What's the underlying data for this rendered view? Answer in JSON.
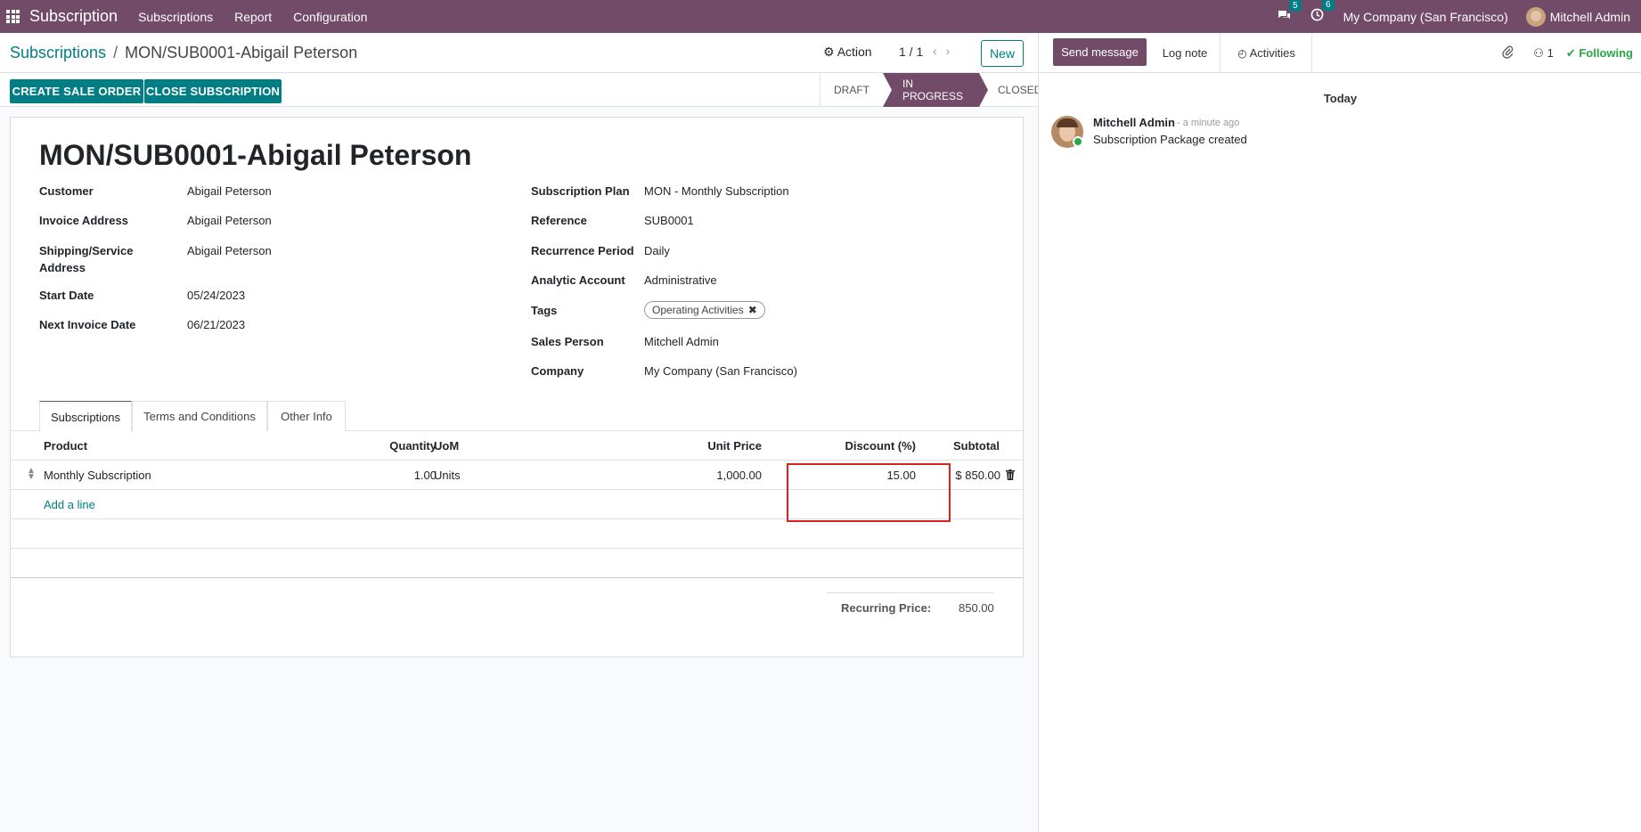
{
  "topnav": {
    "app_name": "Subscription",
    "menu": [
      "Subscriptions",
      "Report",
      "Configuration"
    ],
    "messages_badge": "5",
    "activities_badge": "6",
    "company": "My Company (San Francisco)",
    "user": "Mitchell Admin"
  },
  "control_panel": {
    "breadcrumb_parent": "Subscriptions",
    "breadcrumb_sep": "/",
    "breadcrumb_current": "MON/SUB0001-Abigail Peterson",
    "action_label": "Action",
    "pager": "1 / 1",
    "new_label": "New"
  },
  "statusbar": {
    "create_sale_order": "CREATE SALE ORDER",
    "close_subscription": "CLOSE SUBSCRIPTION",
    "stages": [
      "DRAFT",
      "IN PROGRESS",
      "CLOSED"
    ],
    "active_stage": "IN PROGRESS"
  },
  "record": {
    "title": "MON/SUB0001-Abigail Peterson",
    "left_fields": [
      {
        "label": "Customer",
        "value": "Abigail Peterson"
      },
      {
        "label": "Invoice Address",
        "value": "Abigail Peterson"
      },
      {
        "label": "Shipping/Service Address",
        "value": "Abigail Peterson"
      },
      {
        "label": "Start Date",
        "value": "05/24/2023"
      },
      {
        "label": "Next Invoice Date",
        "value": "06/21/2023"
      }
    ],
    "right_fields": [
      {
        "label": "Subscription Plan",
        "value": "MON - Monthly Subscription"
      },
      {
        "label": "Reference",
        "value": "SUB0001"
      },
      {
        "label": "Recurrence Period",
        "value": "Daily"
      },
      {
        "label": "Analytic Account",
        "value": "Administrative"
      },
      {
        "label": "Tags",
        "value": "Operating Activities"
      },
      {
        "label": "Sales Person",
        "value": "Mitchell Admin"
      },
      {
        "label": "Company",
        "value": "My Company (San Francisco)"
      }
    ]
  },
  "tabs": [
    "Subscriptions",
    "Terms and Conditions",
    "Other Info"
  ],
  "lines_table": {
    "headers": {
      "product": "Product",
      "quantity": "Quantity",
      "uom": "UoM",
      "unit_price": "Unit Price",
      "discount": "Discount (%)",
      "subtotal": "Subtotal"
    },
    "rows": [
      {
        "product": "Monthly Subscription",
        "quantity": "1.00",
        "uom": "Units",
        "unit_price": "1,000.00",
        "discount": "15.00",
        "subtotal": "$ 850.00"
      }
    ],
    "add_line": "Add a line",
    "recurring_price_label": "Recurring Price:",
    "recurring_price_value": "850.00"
  },
  "chatter": {
    "send_message": "Send message",
    "log_note": "Log note",
    "activities": "Activities",
    "followers_count": "1",
    "following": "Following",
    "day": "Today",
    "messages": [
      {
        "author": "Mitchell Admin",
        "time": "- a minute ago",
        "body": "Subscription Package created"
      }
    ]
  },
  "colors": {
    "brand": "#714b67",
    "accent": "#017e84",
    "highlight": "#e02020",
    "following": "#28a745"
  }
}
